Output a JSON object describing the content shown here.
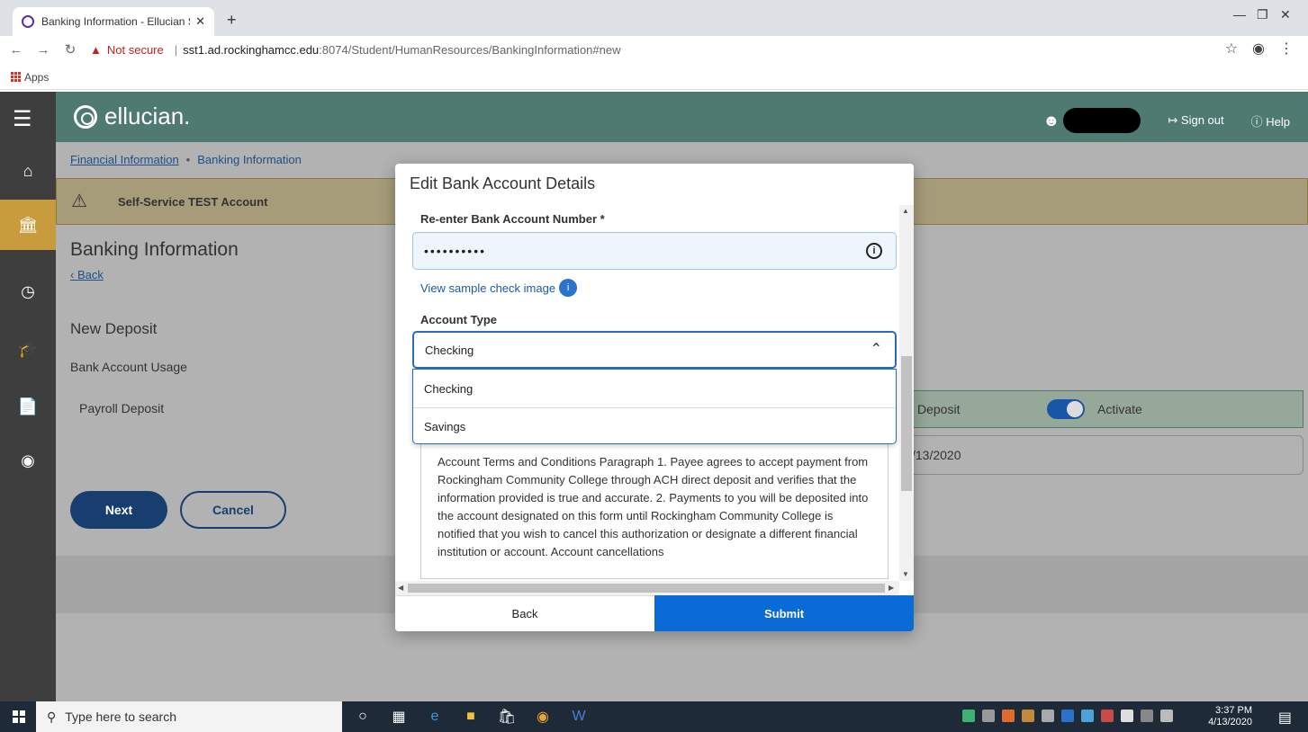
{
  "browser": {
    "tab_title": "Banking Information - Ellucian St",
    "tab_close": "✕",
    "new_tab": "+",
    "not_secure": "Not secure",
    "url_host": "sst1.ad.rockinghamcc.edu",
    "url_path": ":8074/Student/HumanResources/BankingInformation#new",
    "bookmarks_apps": "Apps"
  },
  "header": {
    "logo_text": "ellucian.",
    "sign_out": "Sign out",
    "help": "Help"
  },
  "breadcrumb": {
    "parent": "Financial Information",
    "current": "Banking Information"
  },
  "alert": {
    "text": "Self-Service TEST Account"
  },
  "page": {
    "title": "Banking Information",
    "back": "Back",
    "section_title": "New Deposit",
    "usage_label": "Bank Account Usage",
    "payroll_label": "Payroll Deposit",
    "deposit_label": "Deposit",
    "activate_label": "Activate",
    "date_partial": "/13/2020",
    "next_button": "Next",
    "cancel_button": "Cancel"
  },
  "modal": {
    "title": "Edit Bank Account Details",
    "reenter_label": "Re-enter Bank Account Number *",
    "reenter_value": "••••••••••",
    "sample_link": "View sample check image",
    "account_type_label": "Account Type",
    "account_type_selected": "Checking",
    "account_type_options": [
      "Checking",
      "Savings"
    ],
    "terms_text": "Account Terms and Conditions Paragraph 1. Payee agrees to accept payment from Rockingham Community College through ACH direct deposit and verifies that the information provided is true and accurate. 2. Payments to you will be deposited into the account designated on this form until Rockingham Community College is notified that you wish to cancel this authorization or designate a different financial institution or account. Account cancellations",
    "back_button": "Back",
    "submit_button": "Submit"
  },
  "taskbar": {
    "search_placeholder": "Type here to search",
    "time": "3:37 PM",
    "date": "4/13/2020"
  },
  "colors": {
    "header_bg": "#4e7a72",
    "nav_bg": "#3e3e3e",
    "nav_active": "#c89b3c",
    "primary_button": "#183e70",
    "submit": "#0a6ad6"
  }
}
